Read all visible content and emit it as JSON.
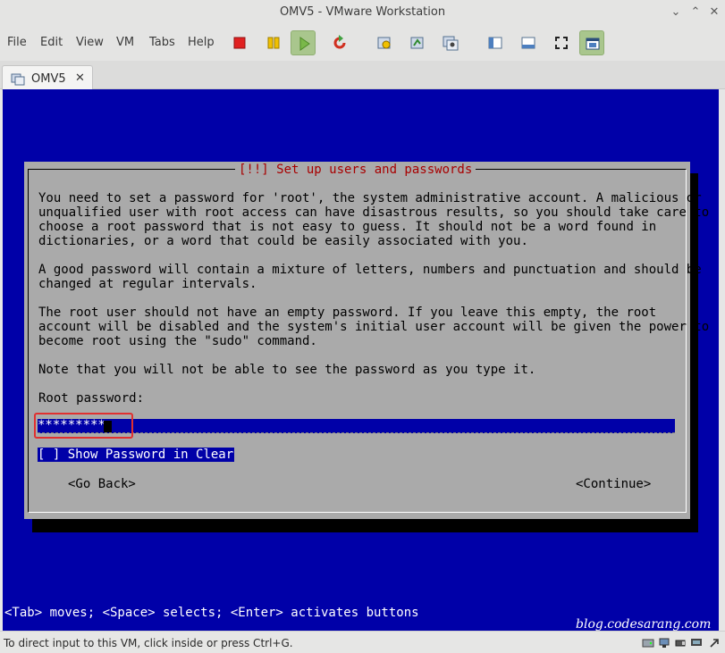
{
  "window": {
    "title": "OMV5 - VMware Workstation",
    "minimize_glyph": "⌄",
    "maximize_glyph": "⌃",
    "close_glyph": "✕"
  },
  "menu": {
    "items": [
      "File",
      "Edit",
      "View",
      "VM",
      "Tabs",
      "Help"
    ]
  },
  "toolbar": {
    "icons": [
      "power-off-icon",
      "suspend-icon",
      "power-on-icon",
      "restart-icon",
      "snapshot-icon",
      "revert-snapshot-icon",
      "snapshot-manager-icon",
      "library-icon",
      "thumbnail-bar-icon",
      "full-screen-icon",
      "unity-icon"
    ],
    "colors": {
      "active_bg": "#a9c68d",
      "power_off": "#e02020",
      "suspend": "#f0c000",
      "power_on": "#7ab84a",
      "restart": "#d03020"
    }
  },
  "tab": {
    "label": "OMV5",
    "close_glyph": "✕"
  },
  "installer": {
    "title": "[!!] Set up users and passwords",
    "para1": "You need to set a password for 'root', the system administrative account. A malicious or\nunqualified user with root access can have disastrous results, so you should take care to\nchoose a root password that is not easy to guess. It should not be a word found in\ndictionaries, or a word that could be easily associated with you.",
    "para2": "A good password will contain a mixture of letters, numbers and punctuation and should be\nchanged at regular intervals.",
    "para3": "The root user should not have an empty password. If you leave this empty, the root\naccount will be disabled and the system's initial user account will be given the power to\nbecome root using the \"sudo\" command.",
    "para4": "Note that you will not be able to see the password as you type it.",
    "field_label": "Root password:",
    "password_value": "*********",
    "show_password_checkbox": "[ ] Show Password in Clear",
    "go_back_button": "<Go Back>",
    "continue_button": "<Continue>",
    "key_hint": "<Tab> moves; <Space> selects; <Enter> activates buttons",
    "colors": {
      "screen_bg": "#0000a8",
      "dialog_bg": "#aaaaaa",
      "title": "#a80000",
      "highlight_box": "#e03030"
    }
  },
  "watermark": "blog.codesarang.com",
  "statusbar": {
    "message": "To direct input to this VM, click inside or press Ctrl+G.",
    "icons": [
      "hard-disk-icon",
      "network-icon",
      "usb-icon",
      "display-icon"
    ]
  }
}
